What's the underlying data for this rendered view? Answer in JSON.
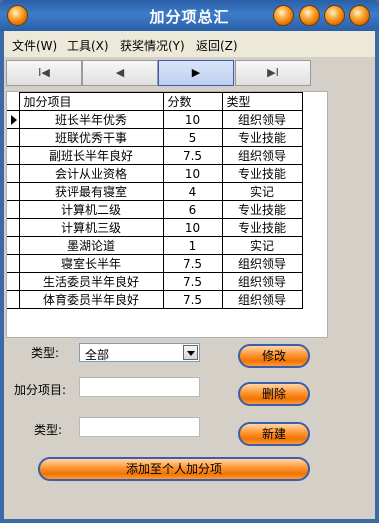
{
  "window": {
    "title": "加分项总汇"
  },
  "menu": [
    "文件(W)",
    "工具(X)",
    "获奖情况(Y)",
    "返回(Z)"
  ],
  "nav": {
    "first": "I◀",
    "prev": "◀",
    "next": "▶",
    "last": "▶I"
  },
  "grid": {
    "headers": [
      "加分项目",
      "分数",
      "类型"
    ],
    "rows": [
      [
        "班长半年优秀",
        "10",
        "组织领导"
      ],
      [
        "班联优秀干事",
        "5",
        "专业技能"
      ],
      [
        "副班长半年良好",
        "7.5",
        "组织领导"
      ],
      [
        "会计从业资格",
        "10",
        "专业技能"
      ],
      [
        "获评最有寝室",
        "4",
        "实记"
      ],
      [
        "计算机二级",
        "6",
        "专业技能"
      ],
      [
        "计算机三级",
        "10",
        "专业技能"
      ],
      [
        "墨湖论道",
        "1",
        "实记"
      ],
      [
        "寝室长半年",
        "7.5",
        "组织领导"
      ],
      [
        "生活委员半年良好",
        "7.5",
        "组织领导"
      ],
      [
        "体育委员半年良好",
        "7.5",
        "组织领导"
      ]
    ]
  },
  "form": {
    "type_label": "类型:",
    "type_value": "全部",
    "item_label": "加分项目:",
    "item_value": "",
    "type2_label": "类型:",
    "type2_value": ""
  },
  "buttons": {
    "modify": "修改",
    "delete": "删除",
    "new": "新建",
    "add_personal": "添加至个人加分项"
  }
}
